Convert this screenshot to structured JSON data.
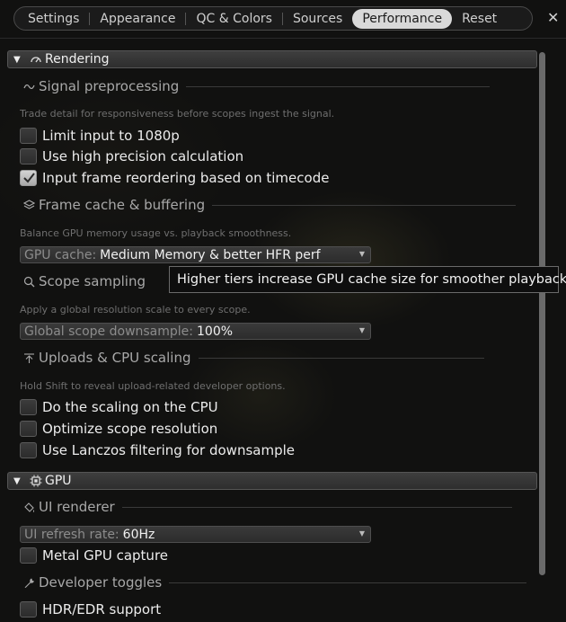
{
  "tabs": [
    {
      "label": "Settings"
    },
    {
      "label": "Appearance"
    },
    {
      "label": "QC & Colors"
    },
    {
      "label": "Sources"
    },
    {
      "label": "Performance",
      "active": true
    },
    {
      "label": "Reset"
    }
  ],
  "close_label": "✕",
  "colors": {
    "accent": "#d9d9d9",
    "background": "#111110",
    "section": "#3a3a3a"
  },
  "rendering": {
    "title": "Rendering",
    "icon": "gauge-icon",
    "signal": {
      "title": "Signal preprocessing",
      "icon": "signal-wave-icon",
      "desc": "Trade detail for responsiveness before scopes ingest the signal.",
      "options": [
        {
          "label": "Limit input to 1080p",
          "checked": false
        },
        {
          "label": "Use high precision calculation",
          "checked": false
        },
        {
          "label": "Input frame reordering based on timecode",
          "checked": true
        }
      ]
    },
    "cache": {
      "title": "Frame cache & buffering",
      "icon": "layers-icon",
      "desc": "Balance GPU memory usage vs. playback smoothness.",
      "dropdown_label": "GPU cache:",
      "dropdown_value": "Medium Memory & better HFR perf"
    },
    "tooltip": "Higher tiers increase GPU cache size for smoother playback.",
    "scope": {
      "title": "Scope sampling",
      "icon": "search-icon",
      "desc": "Apply a global resolution scale to every scope.",
      "dropdown_label": "Global scope downsample:",
      "dropdown_value": "100%"
    },
    "uploads": {
      "title": "Uploads & CPU scaling",
      "icon": "upload-arrow-icon",
      "desc": "Hold Shift to reveal upload-related developer options.",
      "options": [
        {
          "label": "Do the scaling on the CPU",
          "checked": false
        },
        {
          "label": "Optimize scope resolution",
          "checked": false
        },
        {
          "label": "Use Lanczos filtering for downsample",
          "checked": false
        }
      ]
    }
  },
  "gpu": {
    "title": "GPU",
    "icon": "chip-icon",
    "renderer": {
      "title": "UI renderer",
      "icon": "paint-bucket-icon",
      "dropdown_label": "UI refresh rate:",
      "dropdown_value": "60Hz",
      "options": [
        {
          "label": "Metal GPU capture",
          "checked": false
        }
      ]
    },
    "dev": {
      "title": "Developer toggles",
      "icon": "wrench-icon",
      "options": [
        {
          "label": "HDR/EDR support",
          "checked": false
        }
      ]
    }
  }
}
